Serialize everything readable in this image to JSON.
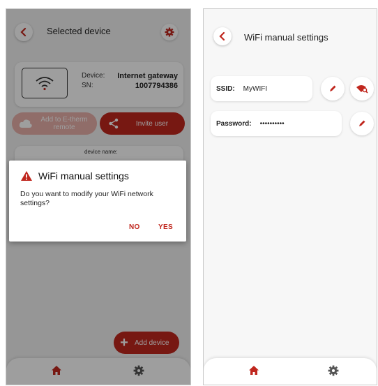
{
  "left_screen": {
    "header": {
      "title": "Selected device"
    },
    "device": {
      "device_label": "Device:",
      "device_value": "Internet gateway",
      "sn_label": "SN:",
      "sn_value": "1007794386"
    },
    "actions": {
      "add_remote_label": "Add to E-therm remote",
      "invite_label": "Invite user"
    },
    "device_name_label": "device name:",
    "add_device_label": "Add device",
    "dialog": {
      "title": "WiFi manual settings",
      "message": "Do you want to modify your WiFi network settings?",
      "no_label": "NO",
      "yes_label": "YES"
    }
  },
  "right_screen": {
    "header": {
      "title": "WiFi manual settings"
    },
    "ssid": {
      "label": "SSID:",
      "value": "MyWIFI"
    },
    "password": {
      "label": "Password:",
      "value": "••••••••••"
    }
  },
  "icons": {
    "back": "chevron-left-icon",
    "settings": "gear-icon",
    "wifi": "wifi-icon",
    "cloud": "cloud-icon",
    "share": "share-icon",
    "plus": "plus-icon",
    "home": "home-icon",
    "edit": "pencil-icon",
    "search_wifi": "wifi-search-icon",
    "warning": "warning-icon"
  },
  "colors": {
    "accent": "#c0271e",
    "accent_faded": "#e8b0aa",
    "screen_bg": "#f2f2f2",
    "overlay": "rgba(0,0,0,0.38)"
  }
}
